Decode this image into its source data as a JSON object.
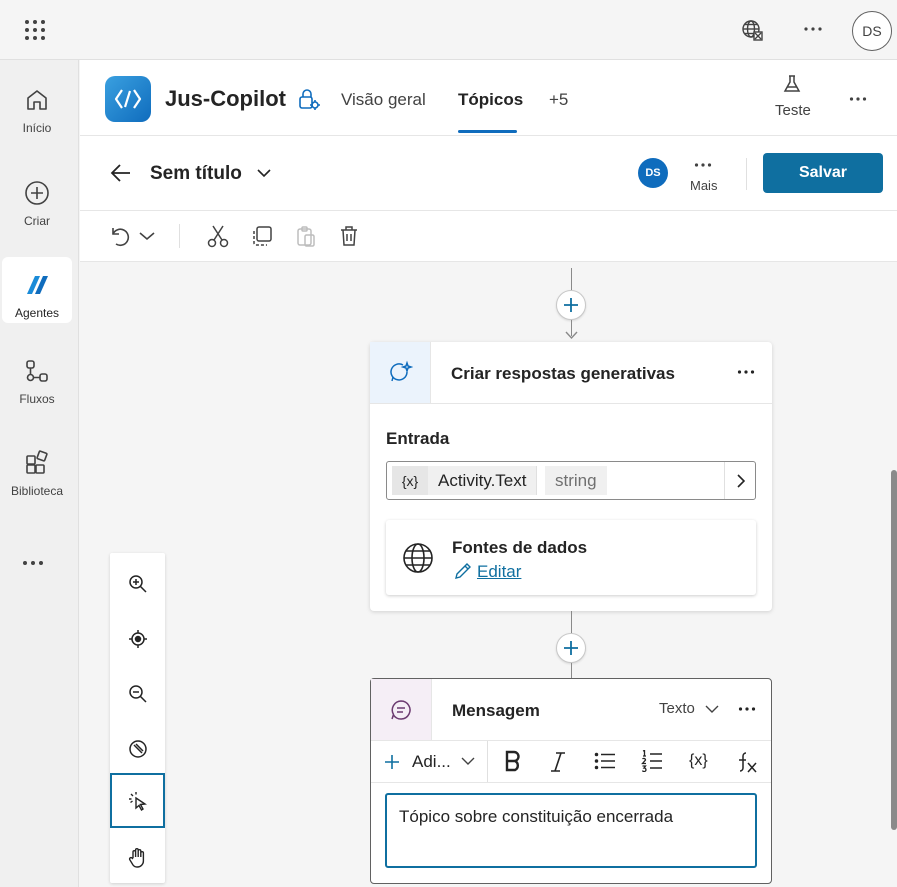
{
  "top_bar": {
    "user_initials": "DS"
  },
  "rail": {
    "items": [
      {
        "label": "Início",
        "icon": "home-icon"
      },
      {
        "label": "Criar",
        "icon": "add-circle-icon"
      },
      {
        "label": "Agentes",
        "icon": "agents-icon",
        "active": true
      },
      {
        "label": "Fluxos",
        "icon": "flow-icon"
      },
      {
        "label": "Biblioteca",
        "icon": "library-icon"
      }
    ]
  },
  "app": {
    "title": "Jus-Copilot",
    "tabs": [
      "Visão geral",
      "Tópicos",
      "+5"
    ],
    "active_tab": "Tópicos",
    "test_label": "Teste"
  },
  "topic_header": {
    "title": "Sem título",
    "user_initials": "DS",
    "more_label": "Mais",
    "save_label": "Salvar"
  },
  "gen_card": {
    "title": "Criar respostas generativas",
    "input_label": "Entrada",
    "var_icon": "{x}",
    "var_name": "Activity.Text",
    "var_type": "string",
    "data_sources_title": "Fontes de dados",
    "edit_label": "Editar"
  },
  "message_card": {
    "title": "Mensagem",
    "type_label": "Texto",
    "add_label": "Adi...",
    "var_label": "{x}",
    "text": "Tópico sobre constituição encerrada"
  },
  "colors": {
    "accent": "#0f6fa0",
    "brand": "#0f6cbd"
  }
}
